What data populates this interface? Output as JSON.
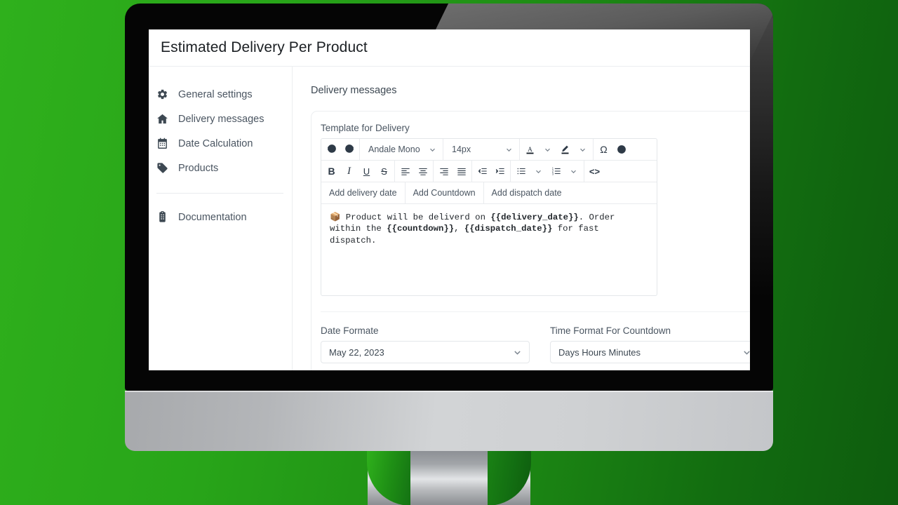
{
  "app": {
    "title": "Estimated Delivery Per Product"
  },
  "sidebar": {
    "items": [
      {
        "label": "General settings",
        "icon": "gear-icon"
      },
      {
        "label": "Delivery messages",
        "icon": "home-icon"
      },
      {
        "label": "Date Calculation",
        "icon": "calendar-icon"
      },
      {
        "label": "Products",
        "icon": "tag-icon"
      }
    ],
    "footer_items": [
      {
        "label": "Documentation",
        "icon": "clipboard-icon"
      }
    ]
  },
  "main": {
    "section_title": "Delivery messages",
    "template": {
      "label": "Template for Delivery",
      "toolbar": {
        "undo": "undo-icon",
        "redo": "redo-icon",
        "font_family": "Andale Mono",
        "font_size": "14px",
        "text_color": "text-color-icon",
        "highlight": "highlight-color-icon",
        "special_char": "Ω",
        "emoji": "☺",
        "bold": "B",
        "italic": "I",
        "underline": "U",
        "strikethrough": "S",
        "align_left": "align-left-icon",
        "align_center": "align-center-icon",
        "align_right": "align-right-icon",
        "align_justify": "align-justify-icon",
        "outdent": "outdent-icon",
        "indent": "indent-icon",
        "bullet_list": "bullet-list-icon",
        "numbered_list": "numbered-list-icon",
        "source_code": "<>"
      },
      "shortcuts": [
        "Add delivery date",
        "Add Countdown",
        "Add dispatch date"
      ],
      "content": {
        "emoji": "📦",
        "line1_pre": "Product will be deliverd on ",
        "line1_token": "{{delivery_date}}",
        "line1_post": ". Order within the",
        "line2_token1": "{{countdown}}",
        "line2_mid": ", ",
        "line2_token2": "{{dispatch_date}}",
        "line2_post": " for fast dispatch."
      }
    },
    "date_format": {
      "label": "Date Formate",
      "value": "May 22, 2023"
    },
    "time_format": {
      "label": "Time Format For Countdown",
      "value": "Days Hours Minutes"
    }
  },
  "colors": {
    "background_start": "#2fb01c",
    "background_end": "#0e5c0e",
    "bezel": "#050505",
    "base": "#cfd1d3",
    "text": "#3d4852"
  }
}
